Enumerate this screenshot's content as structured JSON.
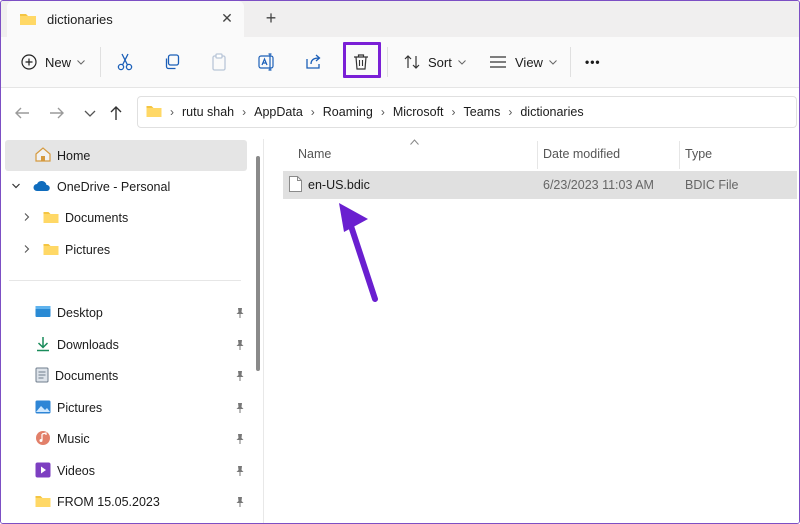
{
  "tab": {
    "title": "dictionaries",
    "close": "✕",
    "new_tab": "+"
  },
  "toolbar": {
    "new_label": "New",
    "sort_label": "Sort",
    "view_label": "View",
    "more": "•••"
  },
  "address": {
    "crumbs": [
      "rutu shah",
      "AppData",
      "Roaming",
      "Microsoft",
      "Teams",
      "dictionaries"
    ]
  },
  "sidebar": {
    "home": "Home",
    "onedrive": "OneDrive - Personal",
    "onedrive_children": [
      "Documents",
      "Pictures"
    ],
    "quick_access": [
      "Desktop",
      "Downloads",
      "Documents",
      "Pictures",
      "Music",
      "Videos",
      "FROM 15.05.2023"
    ]
  },
  "columns": {
    "name": "Name",
    "date": "Date modified",
    "type": "Type"
  },
  "files": [
    {
      "name": "en-US.bdic",
      "date": "6/23/2023 11:03 AM",
      "type": "BDIC File"
    }
  ],
  "colors": {
    "highlight": "#7a1fd6",
    "arrow": "#6a1fd0",
    "folder": "#f4c542",
    "selection": "#e0e0e0"
  }
}
